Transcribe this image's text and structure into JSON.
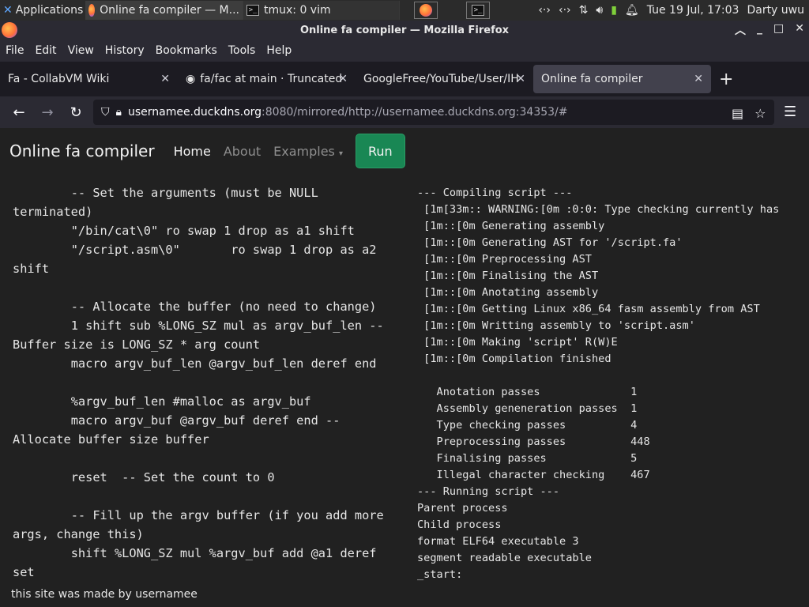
{
  "taskbar": {
    "applications_label": "Applications",
    "windows": [
      {
        "label": "Online fa compiler — M..."
      },
      {
        "label": "tmux: 0 vim"
      }
    ],
    "clock": "Tue 19 Jul, 17:03",
    "user": "Darty uwu",
    "tray_icons": [
      "network-icon",
      "network-icon",
      "updown-icon",
      "volume-icon",
      "battery-icon",
      "bell-icon"
    ]
  },
  "window": {
    "title": "Online fa compiler — Mozilla Firefox"
  },
  "menu": [
    "File",
    "Edit",
    "View",
    "History",
    "Bookmarks",
    "Tools",
    "Help"
  ],
  "tabs": [
    {
      "label": "Fa - CollabVM Wiki",
      "active": false
    },
    {
      "label": "fa/fac at main · Truncated",
      "active": false
    },
    {
      "label": "GoogleFree/YouTube/User/IH",
      "active": false
    },
    {
      "label": "Online fa compiler",
      "active": true
    }
  ],
  "url": {
    "host": "usernamee.duckdns.org",
    "rest": ":8080/mirrored/http://usernamee.duckdns.org:34353/#"
  },
  "site": {
    "brand": "Online fa compiler",
    "nav": {
      "home": "Home",
      "about": "About",
      "examples": "Examples"
    },
    "run_label": "Run",
    "footer": "this site was made by usernamee"
  },
  "editor_code": "        -- Set the arguments (must be NULL terminated)\n        \"/bin/cat\\0\" ro swap 1 drop as a1 shift\n        \"/script.asm\\0\"       ro swap 1 drop as a2 shift\n\n        -- Allocate the buffer (no need to change)\n        1 shift sub %LONG_SZ mul as argv_buf_len -- Buffer size is LONG_SZ * arg count\n        macro argv_buf_len @argv_buf_len deref end\n\n        %argv_buf_len #malloc as argv_buf\n        macro argv_buf @argv_buf deref end -- Allocate buffer size buffer\n\n        reset  -- Set the count to 0\n\n        -- Fill up the argv buffer (if you add more args, change this)\n        shift %LONG_SZ mul %argv_buf add @a1 deref set",
  "output_text": "--- Compiling script ---\n [1m[33m:: WARNING:[0m :0:0: Type checking currently has\n [1m::[0m Generating assembly\n [1m::[0m Generating AST for '/script.fa'\n [1m::[0m Preprocessing AST\n [1m::[0m Finalising the AST\n [1m::[0m Anotating assembly\n [1m::[0m Getting Linux x86_64 fasm assembly from AST\n [1m::[0m Writting assembly to 'script.asm'\n [1m::[0m Making 'script' R(W)E\n [1m::[0m Compilation finished\n\n   Anotation passes              1\n   Assembly geneneration passes  1\n   Type checking passes          4\n   Preprocessing passes          448\n   Finalising passes             5\n   Illegal character checking    467\n--- Running script ---\nParent process\nChild process\nformat ELF64 executable 3\nsegment readable executable\n_start:"
}
